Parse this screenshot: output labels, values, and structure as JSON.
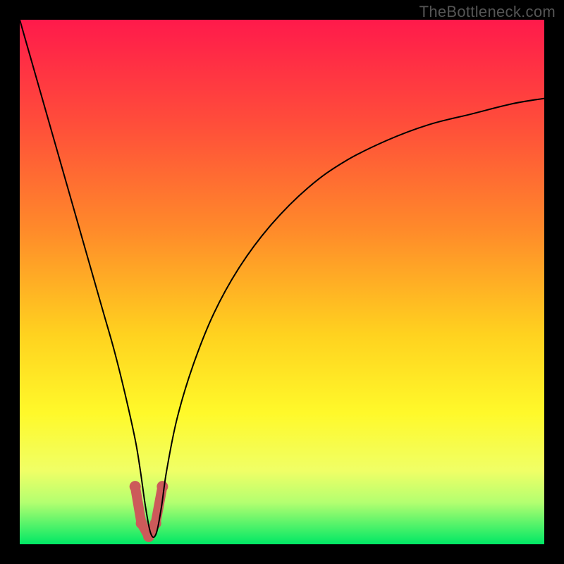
{
  "watermark": "TheBottleneck.com",
  "chart_data": {
    "type": "line",
    "title": "",
    "xlabel": "",
    "ylabel": "",
    "xlim": [
      0,
      100
    ],
    "ylim": [
      0,
      100
    ],
    "grid": false,
    "legend": false,
    "background_gradient_stops": [
      {
        "offset": 0,
        "color": "#ff1a4b"
      },
      {
        "offset": 20,
        "color": "#ff4e3a"
      },
      {
        "offset": 40,
        "color": "#ff8a2a"
      },
      {
        "offset": 60,
        "color": "#ffd21f"
      },
      {
        "offset": 75,
        "color": "#fff92a"
      },
      {
        "offset": 86,
        "color": "#f0ff66"
      },
      {
        "offset": 92,
        "color": "#b4ff70"
      },
      {
        "offset": 100,
        "color": "#00e865"
      }
    ],
    "series": [
      {
        "name": "bottleneck-curve",
        "color": "#000000",
        "stroke_width": 2,
        "x": [
          0,
          2,
          4,
          6,
          8,
          10,
          12,
          14,
          16,
          18,
          20,
          22,
          23,
          24,
          25,
          26,
          27,
          28,
          30,
          33,
          37,
          42,
          48,
          55,
          62,
          70,
          78,
          86,
          94,
          100
        ],
        "y": [
          100,
          93,
          86,
          79,
          72,
          65,
          58,
          51,
          44,
          37,
          29,
          20,
          14,
          7,
          2,
          2,
          7,
          14,
          24,
          34,
          44,
          53,
          61,
          68,
          73,
          77,
          80,
          82,
          84,
          85
        ]
      },
      {
        "name": "markers",
        "type": "scatter",
        "color": "#cc5a5a",
        "marker_radius": 8,
        "x": [
          22,
          23.2,
          24.6,
          25.9,
          27.2
        ],
        "y": [
          11,
          4,
          1.5,
          4,
          11
        ]
      }
    ],
    "marker_segment": {
      "color": "#cc5a5a",
      "stroke_width": 14,
      "x": [
        22,
        23.2,
        24.6,
        25.9,
        27.2
      ],
      "y": [
        11,
        4,
        1.5,
        4,
        11
      ]
    }
  }
}
